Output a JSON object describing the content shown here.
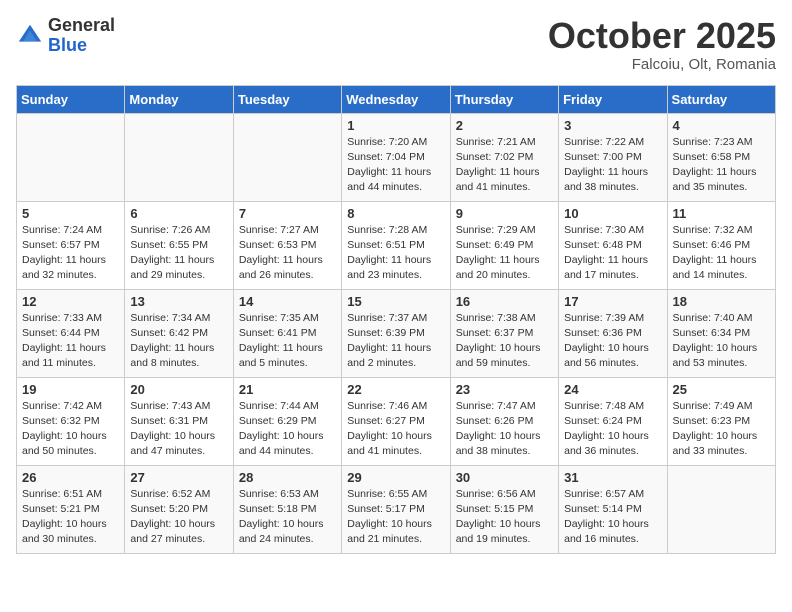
{
  "header": {
    "logo_general": "General",
    "logo_blue": "Blue",
    "title": "October 2025",
    "location": "Falcoiu, Olt, Romania"
  },
  "days_of_week": [
    "Sunday",
    "Monday",
    "Tuesday",
    "Wednesday",
    "Thursday",
    "Friday",
    "Saturday"
  ],
  "weeks": [
    [
      {
        "day": "",
        "sunrise": "",
        "sunset": "",
        "daylight": ""
      },
      {
        "day": "",
        "sunrise": "",
        "sunset": "",
        "daylight": ""
      },
      {
        "day": "",
        "sunrise": "",
        "sunset": "",
        "daylight": ""
      },
      {
        "day": "1",
        "sunrise": "Sunrise: 7:20 AM",
        "sunset": "Sunset: 7:04 PM",
        "daylight": "Daylight: 11 hours and 44 minutes."
      },
      {
        "day": "2",
        "sunrise": "Sunrise: 7:21 AM",
        "sunset": "Sunset: 7:02 PM",
        "daylight": "Daylight: 11 hours and 41 minutes."
      },
      {
        "day": "3",
        "sunrise": "Sunrise: 7:22 AM",
        "sunset": "Sunset: 7:00 PM",
        "daylight": "Daylight: 11 hours and 38 minutes."
      },
      {
        "day": "4",
        "sunrise": "Sunrise: 7:23 AM",
        "sunset": "Sunset: 6:58 PM",
        "daylight": "Daylight: 11 hours and 35 minutes."
      }
    ],
    [
      {
        "day": "5",
        "sunrise": "Sunrise: 7:24 AM",
        "sunset": "Sunset: 6:57 PM",
        "daylight": "Daylight: 11 hours and 32 minutes."
      },
      {
        "day": "6",
        "sunrise": "Sunrise: 7:26 AM",
        "sunset": "Sunset: 6:55 PM",
        "daylight": "Daylight: 11 hours and 29 minutes."
      },
      {
        "day": "7",
        "sunrise": "Sunrise: 7:27 AM",
        "sunset": "Sunset: 6:53 PM",
        "daylight": "Daylight: 11 hours and 26 minutes."
      },
      {
        "day": "8",
        "sunrise": "Sunrise: 7:28 AM",
        "sunset": "Sunset: 6:51 PM",
        "daylight": "Daylight: 11 hours and 23 minutes."
      },
      {
        "day": "9",
        "sunrise": "Sunrise: 7:29 AM",
        "sunset": "Sunset: 6:49 PM",
        "daylight": "Daylight: 11 hours and 20 minutes."
      },
      {
        "day": "10",
        "sunrise": "Sunrise: 7:30 AM",
        "sunset": "Sunset: 6:48 PM",
        "daylight": "Daylight: 11 hours and 17 minutes."
      },
      {
        "day": "11",
        "sunrise": "Sunrise: 7:32 AM",
        "sunset": "Sunset: 6:46 PM",
        "daylight": "Daylight: 11 hours and 14 minutes."
      }
    ],
    [
      {
        "day": "12",
        "sunrise": "Sunrise: 7:33 AM",
        "sunset": "Sunset: 6:44 PM",
        "daylight": "Daylight: 11 hours and 11 minutes."
      },
      {
        "day": "13",
        "sunrise": "Sunrise: 7:34 AM",
        "sunset": "Sunset: 6:42 PM",
        "daylight": "Daylight: 11 hours and 8 minutes."
      },
      {
        "day": "14",
        "sunrise": "Sunrise: 7:35 AM",
        "sunset": "Sunset: 6:41 PM",
        "daylight": "Daylight: 11 hours and 5 minutes."
      },
      {
        "day": "15",
        "sunrise": "Sunrise: 7:37 AM",
        "sunset": "Sunset: 6:39 PM",
        "daylight": "Daylight: 11 hours and 2 minutes."
      },
      {
        "day": "16",
        "sunrise": "Sunrise: 7:38 AM",
        "sunset": "Sunset: 6:37 PM",
        "daylight": "Daylight: 10 hours and 59 minutes."
      },
      {
        "day": "17",
        "sunrise": "Sunrise: 7:39 AM",
        "sunset": "Sunset: 6:36 PM",
        "daylight": "Daylight: 10 hours and 56 minutes."
      },
      {
        "day": "18",
        "sunrise": "Sunrise: 7:40 AM",
        "sunset": "Sunset: 6:34 PM",
        "daylight": "Daylight: 10 hours and 53 minutes."
      }
    ],
    [
      {
        "day": "19",
        "sunrise": "Sunrise: 7:42 AM",
        "sunset": "Sunset: 6:32 PM",
        "daylight": "Daylight: 10 hours and 50 minutes."
      },
      {
        "day": "20",
        "sunrise": "Sunrise: 7:43 AM",
        "sunset": "Sunset: 6:31 PM",
        "daylight": "Daylight: 10 hours and 47 minutes."
      },
      {
        "day": "21",
        "sunrise": "Sunrise: 7:44 AM",
        "sunset": "Sunset: 6:29 PM",
        "daylight": "Daylight: 10 hours and 44 minutes."
      },
      {
        "day": "22",
        "sunrise": "Sunrise: 7:46 AM",
        "sunset": "Sunset: 6:27 PM",
        "daylight": "Daylight: 10 hours and 41 minutes."
      },
      {
        "day": "23",
        "sunrise": "Sunrise: 7:47 AM",
        "sunset": "Sunset: 6:26 PM",
        "daylight": "Daylight: 10 hours and 38 minutes."
      },
      {
        "day": "24",
        "sunrise": "Sunrise: 7:48 AM",
        "sunset": "Sunset: 6:24 PM",
        "daylight": "Daylight: 10 hours and 36 minutes."
      },
      {
        "day": "25",
        "sunrise": "Sunrise: 7:49 AM",
        "sunset": "Sunset: 6:23 PM",
        "daylight": "Daylight: 10 hours and 33 minutes."
      }
    ],
    [
      {
        "day": "26",
        "sunrise": "Sunrise: 6:51 AM",
        "sunset": "Sunset: 5:21 PM",
        "daylight": "Daylight: 10 hours and 30 minutes."
      },
      {
        "day": "27",
        "sunrise": "Sunrise: 6:52 AM",
        "sunset": "Sunset: 5:20 PM",
        "daylight": "Daylight: 10 hours and 27 minutes."
      },
      {
        "day": "28",
        "sunrise": "Sunrise: 6:53 AM",
        "sunset": "Sunset: 5:18 PM",
        "daylight": "Daylight: 10 hours and 24 minutes."
      },
      {
        "day": "29",
        "sunrise": "Sunrise: 6:55 AM",
        "sunset": "Sunset: 5:17 PM",
        "daylight": "Daylight: 10 hours and 21 minutes."
      },
      {
        "day": "30",
        "sunrise": "Sunrise: 6:56 AM",
        "sunset": "Sunset: 5:15 PM",
        "daylight": "Daylight: 10 hours and 19 minutes."
      },
      {
        "day": "31",
        "sunrise": "Sunrise: 6:57 AM",
        "sunset": "Sunset: 5:14 PM",
        "daylight": "Daylight: 10 hours and 16 minutes."
      },
      {
        "day": "",
        "sunrise": "",
        "sunset": "",
        "daylight": ""
      }
    ]
  ]
}
